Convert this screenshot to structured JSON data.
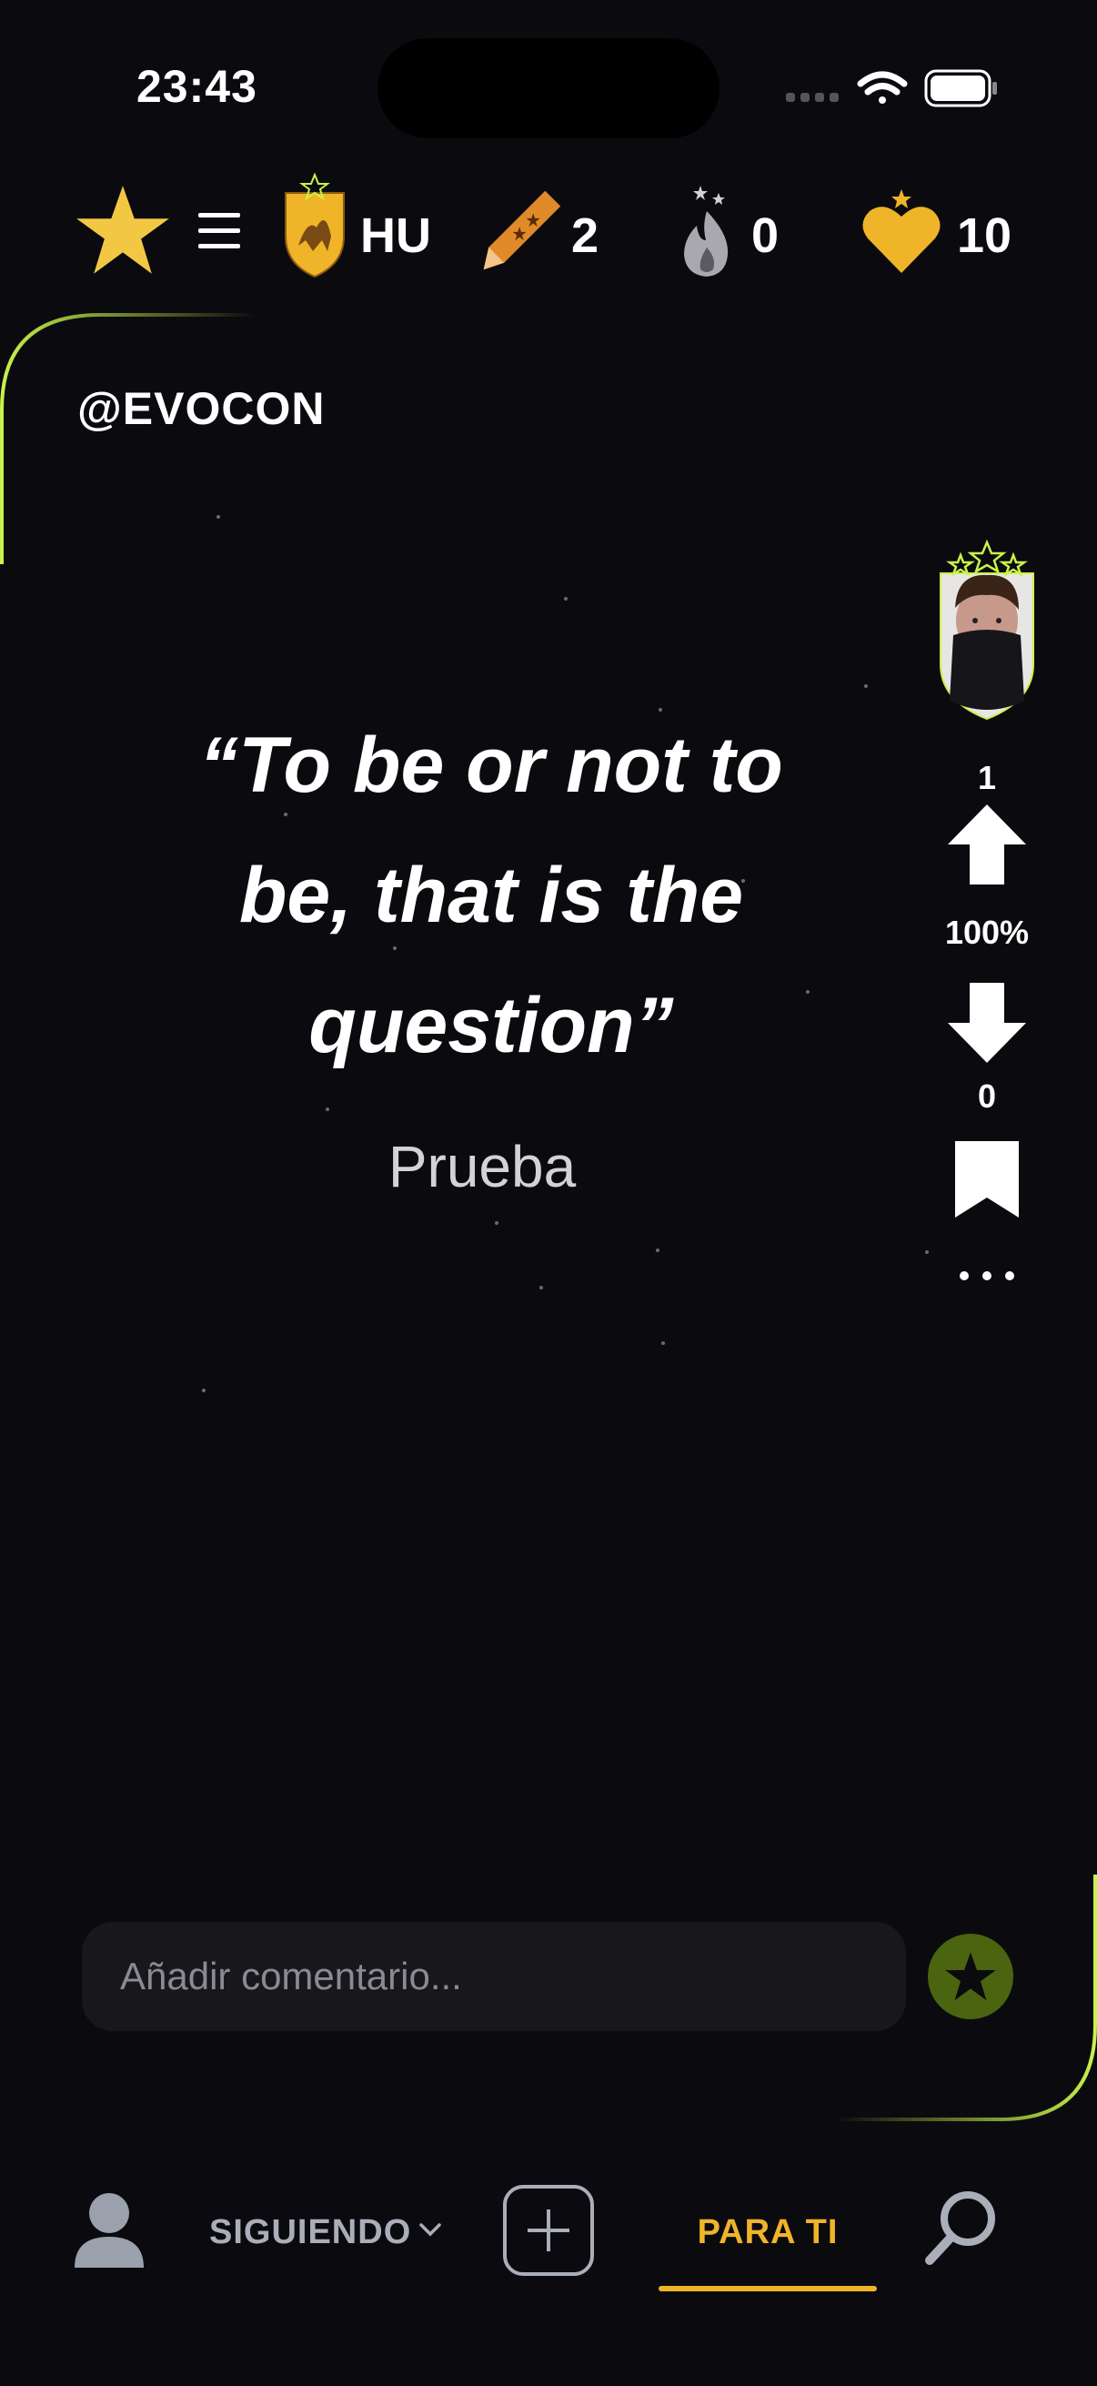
{
  "status_bar": {
    "time": "23:43"
  },
  "top_bar": {
    "team_code": "HU",
    "pencils": "2",
    "flames": "0",
    "hearts": "10"
  },
  "post": {
    "author_handle": "@EVOCON",
    "quote": "“To be or not to be, that is the question”",
    "attribution": "Prueba",
    "upvotes": "1",
    "approval": "100%",
    "downvotes": "0"
  },
  "comment": {
    "placeholder": "Añadir comentario..."
  },
  "bottom_nav": {
    "following_label": "SIGUIENDO",
    "for_you_label": "PARA TI"
  },
  "colors": {
    "accent_yellow": "#f0b429",
    "accent_lime": "#c9f24a",
    "background": "#0b0b0f"
  },
  "icons": [
    "star-icon",
    "menu-icon",
    "team-shield-icon",
    "pencil-icon",
    "flame-icon",
    "heart-icon",
    "upvote-arrow-icon",
    "downvote-arrow-icon",
    "bookmark-icon",
    "more-icon",
    "send-star-icon",
    "profile-icon",
    "chevron-down-icon",
    "create-post-icon",
    "search-icon"
  ]
}
